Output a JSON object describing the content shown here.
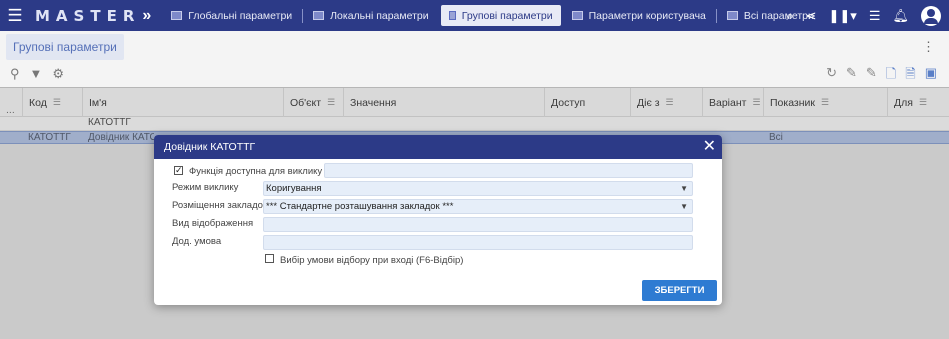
{
  "app": {
    "brand": "MASTER"
  },
  "nav": {
    "tabs": [
      {
        "label": "Глобальні параметри"
      },
      {
        "label": "Локальні параметри"
      },
      {
        "label": "Групові параметри"
      },
      {
        "label": "Параметри користувача"
      },
      {
        "label": "Всі параметри"
      }
    ]
  },
  "page": {
    "tab_label": "Групові параметри"
  },
  "grid": {
    "columns": [
      "Код",
      "Ім'я",
      "Об'єкт",
      "Значення",
      "Доступ",
      "Діє з",
      "Варіант",
      "Показник",
      "Для"
    ],
    "filter_text": "КАТОТТГ",
    "row": {
      "code": "КАТОТТГ",
      "name": "Довідник КАТОТТГ",
      "indicator": "Всі"
    },
    "row_marker": "..."
  },
  "dialog": {
    "title": "Довідник КАТОТТГ",
    "fields": {
      "call_enabled_label": "Функція доступна для виклику",
      "call_enabled_checked": true,
      "call_mode_label": "Режим виклику",
      "call_mode_value": "Коригування",
      "tab_placement_label": "Розміщення закладок",
      "tab_placement_value": "*** Стандартне розташування закладок ***",
      "view_label": "Вид відображення",
      "view_value": "",
      "extra_condition_label": "Дод. умова",
      "extra_condition_value": "",
      "select_on_enter_label": "Вибір умови відбору при вході (F6-Відбір)",
      "select_on_enter_checked": false
    },
    "save_label": "ЗБЕРЕГТИ",
    "close_symbol": "✕"
  },
  "colors": {
    "navbar": "#2c3a87",
    "accent": "#2e7bd2",
    "selected_row": "#b7c6e6"
  }
}
